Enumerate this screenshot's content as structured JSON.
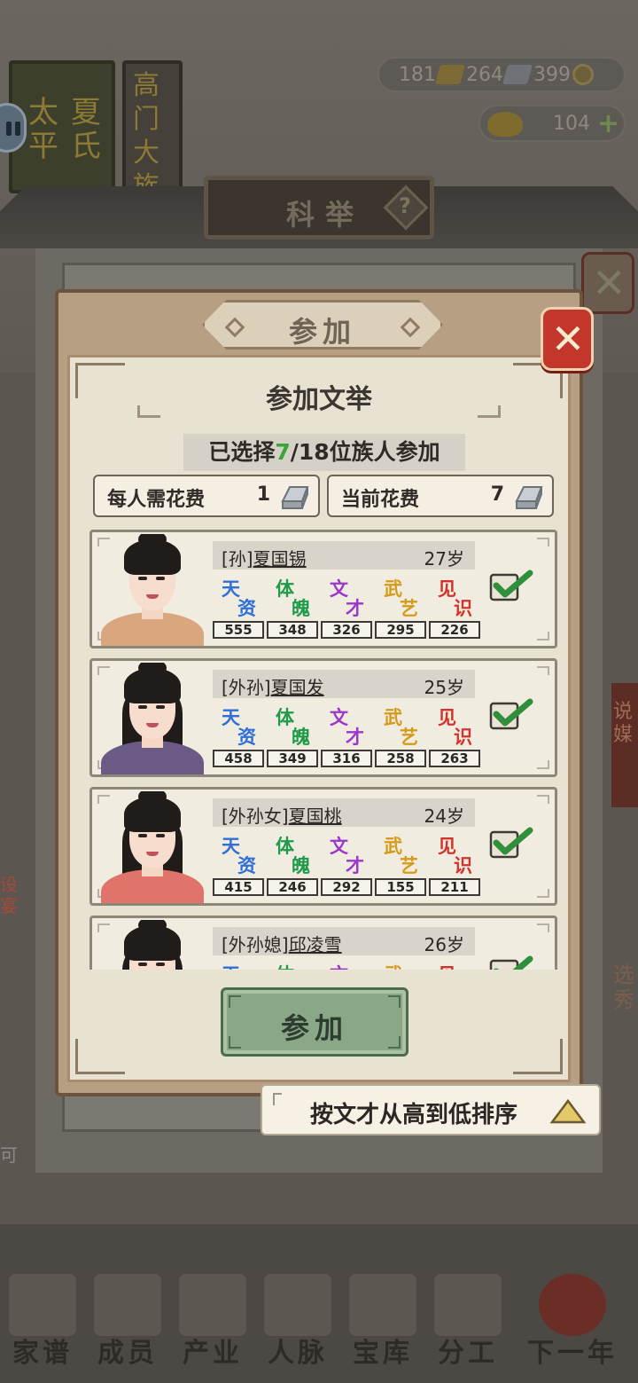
{
  "background": {
    "book_text_1": "太平",
    "book_text_2": "夏氏",
    "book_text_3": "高门大族",
    "resources": {
      "gold": "181",
      "silver": "264",
      "coin": "399"
    },
    "ingot": "104",
    "panel_title": "科举",
    "side_text_right": "说媒",
    "side_text_left": "设宴",
    "side_text_right2": "选秀",
    "side_text_left2": "可",
    "nav": [
      "家谱",
      "成员",
      "产业",
      "人脉",
      "宝库",
      "分工",
      "下一年"
    ]
  },
  "modal": {
    "title": "参加",
    "section_title": "参加文举",
    "selected": "7",
    "select_prefix": "已选择",
    "select_suffix": "/18位族人参加",
    "cost_per_person_label": "每人需花费",
    "cost_per_person_value": "1",
    "current_cost_label": "当前花费",
    "current_cost_value": "7",
    "join_button": "参加",
    "close_icon": "close-icon"
  },
  "stat_labels": [
    {
      "c1": "天",
      "c2": "资",
      "color": "#2f6fd6"
    },
    {
      "c1": "体",
      "c2": "魄",
      "color": "#1f9a4a"
    },
    {
      "c1": "文",
      "c2": "才",
      "color": "#9b37c9"
    },
    {
      "c1": "武",
      "c2": "艺",
      "color": "#d49a1a"
    },
    {
      "c1": "见",
      "c2": "识",
      "color": "#d2332b"
    }
  ],
  "members": [
    {
      "relation": "[孙]",
      "name": "夏国锡",
      "age": "27岁",
      "stats": [
        "555",
        "348",
        "326",
        "295",
        "226"
      ],
      "selected": true,
      "robe": "#d9a67e"
    },
    {
      "relation": "[外孙]",
      "name": "夏国发",
      "age": "25岁",
      "stats": [
        "458",
        "349",
        "316",
        "258",
        "263"
      ],
      "selected": true,
      "robe": "#6b5a86"
    },
    {
      "relation": "[外孙女]",
      "name": "夏国桃",
      "age": "24岁",
      "stats": [
        "415",
        "246",
        "292",
        "155",
        "211"
      ],
      "selected": true,
      "robe": "#e0736a"
    },
    {
      "relation": "[外孙媳]",
      "name": "邱凌雪",
      "age": "26岁",
      "stats": [
        "",
        "",
        "",
        "",
        ""
      ],
      "selected": true,
      "robe": "#7d8a6a"
    }
  ],
  "sort_label": "按文才从高到低排序"
}
